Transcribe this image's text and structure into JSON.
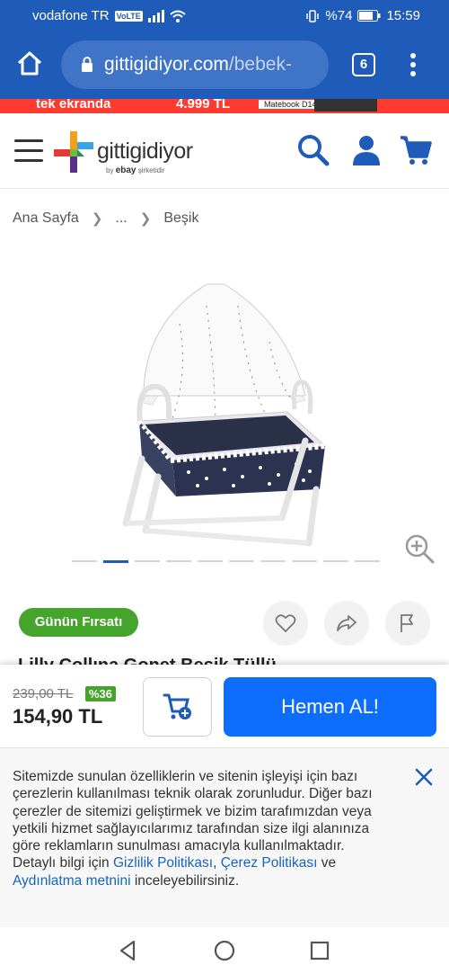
{
  "status_bar": {
    "carrier": "vodafone TR",
    "volte": "VoLTE",
    "battery": "%74",
    "time": "15:59"
  },
  "browser": {
    "url_domain": "gittigidiyor.com",
    "url_path": "/bebek-",
    "tab_count": "6"
  },
  "ad_banner": {
    "text_left": "tek ekranda",
    "price": "4.999 TL",
    "product": "Matebook D14"
  },
  "header": {
    "logo_text": "gittigidiyor",
    "logo_sub_by": "by",
    "logo_sub_brand": "ebay",
    "logo_sub_tail": "şirketidir"
  },
  "breadcrumb": {
    "items": [
      "Ana Sayfa",
      "...",
      "Beşik"
    ]
  },
  "gallery": {
    "image_count": 10,
    "active_index": 1
  },
  "deal_badge": "Günün Fırsatı",
  "product": {
    "title_peek": "Lilly Collına Gonet Beşik Tüllü"
  },
  "buy_bar": {
    "old_price": "239,00 TL",
    "discount": "%36",
    "price": "154,90 TL",
    "buy_now_label": "Hemen AL!"
  },
  "cookie": {
    "text_main": "Sitemizde sunulan özelliklerin ve sitenin işleyişi için bazı çerezlerin kullanılması teknik olarak zorunludur. Diğer bazı çerezler de sitemizi geliştirmek ve bizim tarafımızdan veya yetkili hizmet sağlayıcılarımız tarafından size ilgi alanınıza göre reklamların sunulması amacıyla kullanılmaktadır. Detaylı bilgi için ",
    "link_privacy": "Gizlilik Politikası",
    "comma": ", ",
    "link_cookie": "Çerez Politikası",
    "and": " ve ",
    "link_disclosure": "Aydınlatma metnini",
    "text_end": " inceleyebilirsiniz."
  },
  "colors": {
    "browser_blue": "#1f5bb8",
    "primary_button": "#0d6efd",
    "green": "#45a42b"
  }
}
